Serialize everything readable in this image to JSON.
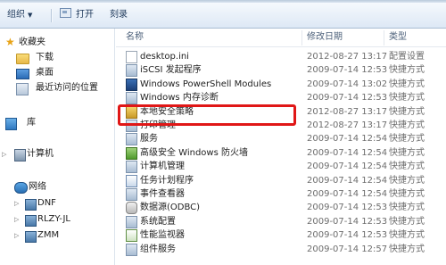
{
  "toolbar": {
    "organize_label": "组织",
    "open_label": "打开",
    "burn_label": "刻录"
  },
  "nav": {
    "favorites_label": "收藏夹",
    "downloads_label": "下载",
    "desktop_label": "桌面",
    "recent_label": "最近访问的位置",
    "libraries_label": "库",
    "computer_label": "计算机",
    "network_label": "网络",
    "hosts": [
      "DNF",
      "RLZY-JL",
      "ZMM"
    ]
  },
  "columns": {
    "name": "名称",
    "date": "修改日期",
    "type": "类型"
  },
  "files": [
    {
      "name": "desktop.ini",
      "date": "2012-08-27 13:17",
      "type": "配置设置",
      "icon": "ini-file-icon"
    },
    {
      "name": "iSCSI 发起程序",
      "date": "2009-07-14 12:53",
      "type": "快捷方式",
      "icon": "shortcut-icon"
    },
    {
      "name": "Windows PowerShell Modules",
      "date": "2009-07-14 13:02",
      "type": "快捷方式",
      "icon": "powershell-icon"
    },
    {
      "name": "Windows 内存诊断",
      "date": "2009-07-14 12:53",
      "type": "快捷方式",
      "icon": "memory-diagnostic-icon"
    },
    {
      "name": "本地安全策略",
      "date": "2012-08-27 13:17",
      "type": "快捷方式",
      "icon": "security-policy-icon"
    },
    {
      "name": "打印管理",
      "date": "2012-08-27 13:17",
      "type": "快捷方式",
      "icon": "print-management-icon"
    },
    {
      "name": "服务",
      "date": "2009-07-14 12:54",
      "type": "快捷方式",
      "icon": "services-icon"
    },
    {
      "name": "高级安全 Windows 防火墙",
      "date": "2009-07-14 12:54",
      "type": "快捷方式",
      "icon": "firewall-icon"
    },
    {
      "name": "计算机管理",
      "date": "2009-07-14 12:54",
      "type": "快捷方式",
      "icon": "computer-management-icon"
    },
    {
      "name": "任务计划程序",
      "date": "2009-07-14 12:54",
      "type": "快捷方式",
      "icon": "task-scheduler-icon"
    },
    {
      "name": "事件查看器",
      "date": "2009-07-14 12:54",
      "type": "快捷方式",
      "icon": "event-viewer-icon"
    },
    {
      "name": "数据源(ODBC)",
      "date": "2009-07-14 12:53",
      "type": "快捷方式",
      "icon": "odbc-icon"
    },
    {
      "name": "系统配置",
      "date": "2009-07-14 12:53",
      "type": "快捷方式",
      "icon": "system-config-icon"
    },
    {
      "name": "性能监视器",
      "date": "2009-07-14 12:53",
      "type": "快捷方式",
      "icon": "performance-monitor-icon"
    },
    {
      "name": "组件服务",
      "date": "2009-07-14 12:57",
      "type": "快捷方式",
      "icon": "component-services-icon"
    }
  ],
  "highlighted_file": "本地安全策略",
  "colors": {
    "highlight": "#e01717",
    "toolbar_text": "#1e395b",
    "meta_text": "#6d6d6d"
  }
}
